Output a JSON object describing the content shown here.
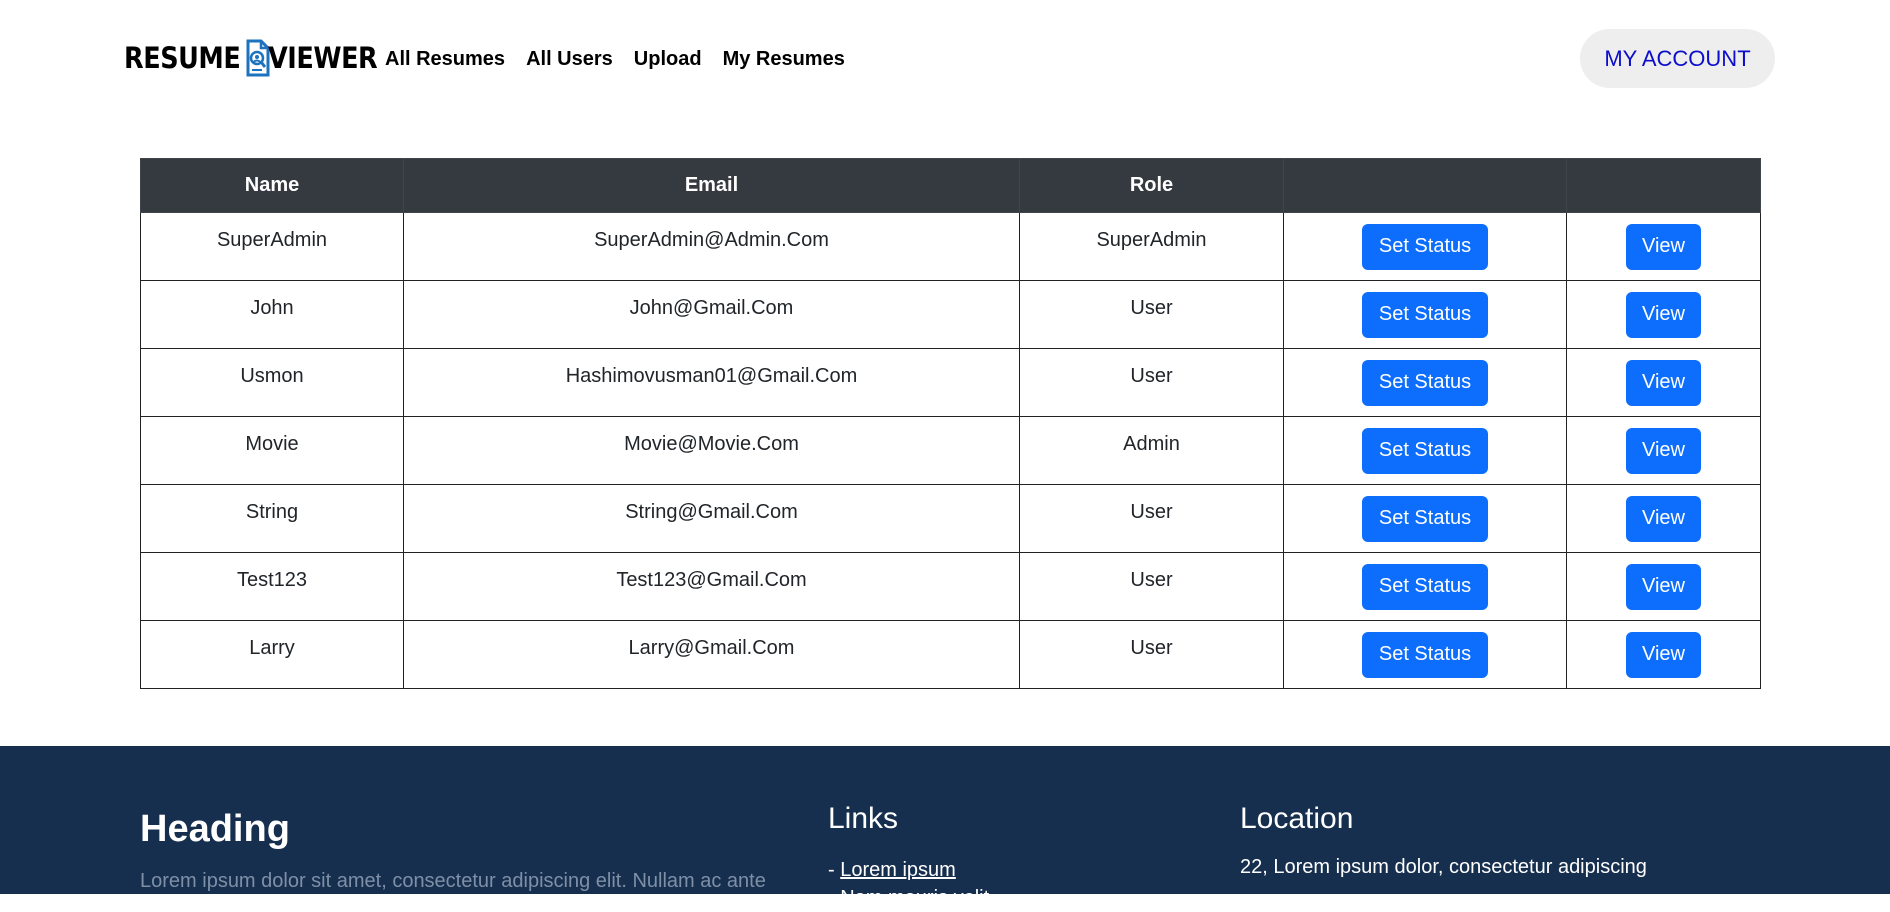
{
  "header": {
    "logo_word_1": "RESUME",
    "logo_word_2": "VIEWER",
    "logo_icon": "resume-magnifier-icon",
    "nav": [
      {
        "label": "All Resumes"
      },
      {
        "label": "All Users"
      },
      {
        "label": "Upload"
      },
      {
        "label": "My Resumes"
      }
    ],
    "account_label": "MY ACCOUNT"
  },
  "table": {
    "columns": [
      "Name",
      "Email",
      "Role",
      "",
      ""
    ],
    "rows": [
      {
        "name": "SuperAdmin",
        "email": "SuperAdmin@Admin.Com",
        "role": "SuperAdmin",
        "status_label": "Set Status",
        "view_label": "View"
      },
      {
        "name": "John",
        "email": "John@Gmail.Com",
        "role": "User",
        "status_label": "Set Status",
        "view_label": "View"
      },
      {
        "name": "Usmon",
        "email": "Hashimovusman01@Gmail.Com",
        "role": "User",
        "status_label": "Set Status",
        "view_label": "View"
      },
      {
        "name": "Movie",
        "email": "Movie@Movie.Com",
        "role": "Admin",
        "status_label": "Set Status",
        "view_label": "View"
      },
      {
        "name": "String",
        "email": "String@Gmail.Com",
        "role": "User",
        "status_label": "Set Status",
        "view_label": "View"
      },
      {
        "name": "Test123",
        "email": "Test123@Gmail.Com",
        "role": "User",
        "status_label": "Set Status",
        "view_label": "View"
      },
      {
        "name": "Larry",
        "email": "Larry@Gmail.Com",
        "role": "User",
        "status_label": "Set Status",
        "view_label": "View"
      }
    ]
  },
  "footer": {
    "heading": "Heading",
    "text": "Lorem ipsum dolor sit amet, consectetur adipiscing elit. Nullam ac ante",
    "links_title": "Links",
    "link_prefix": "- ",
    "links": [
      "Lorem ipsum",
      "Nam mauris velit"
    ],
    "location_title": "Location",
    "location_text": "22, Lorem ipsum dolor, consectetur adipiscing"
  },
  "colors": {
    "primary_button": "#0d6efd",
    "table_header": "#343a40",
    "footer_bg": "#172f4f",
    "account_text": "#0d0dcc"
  }
}
